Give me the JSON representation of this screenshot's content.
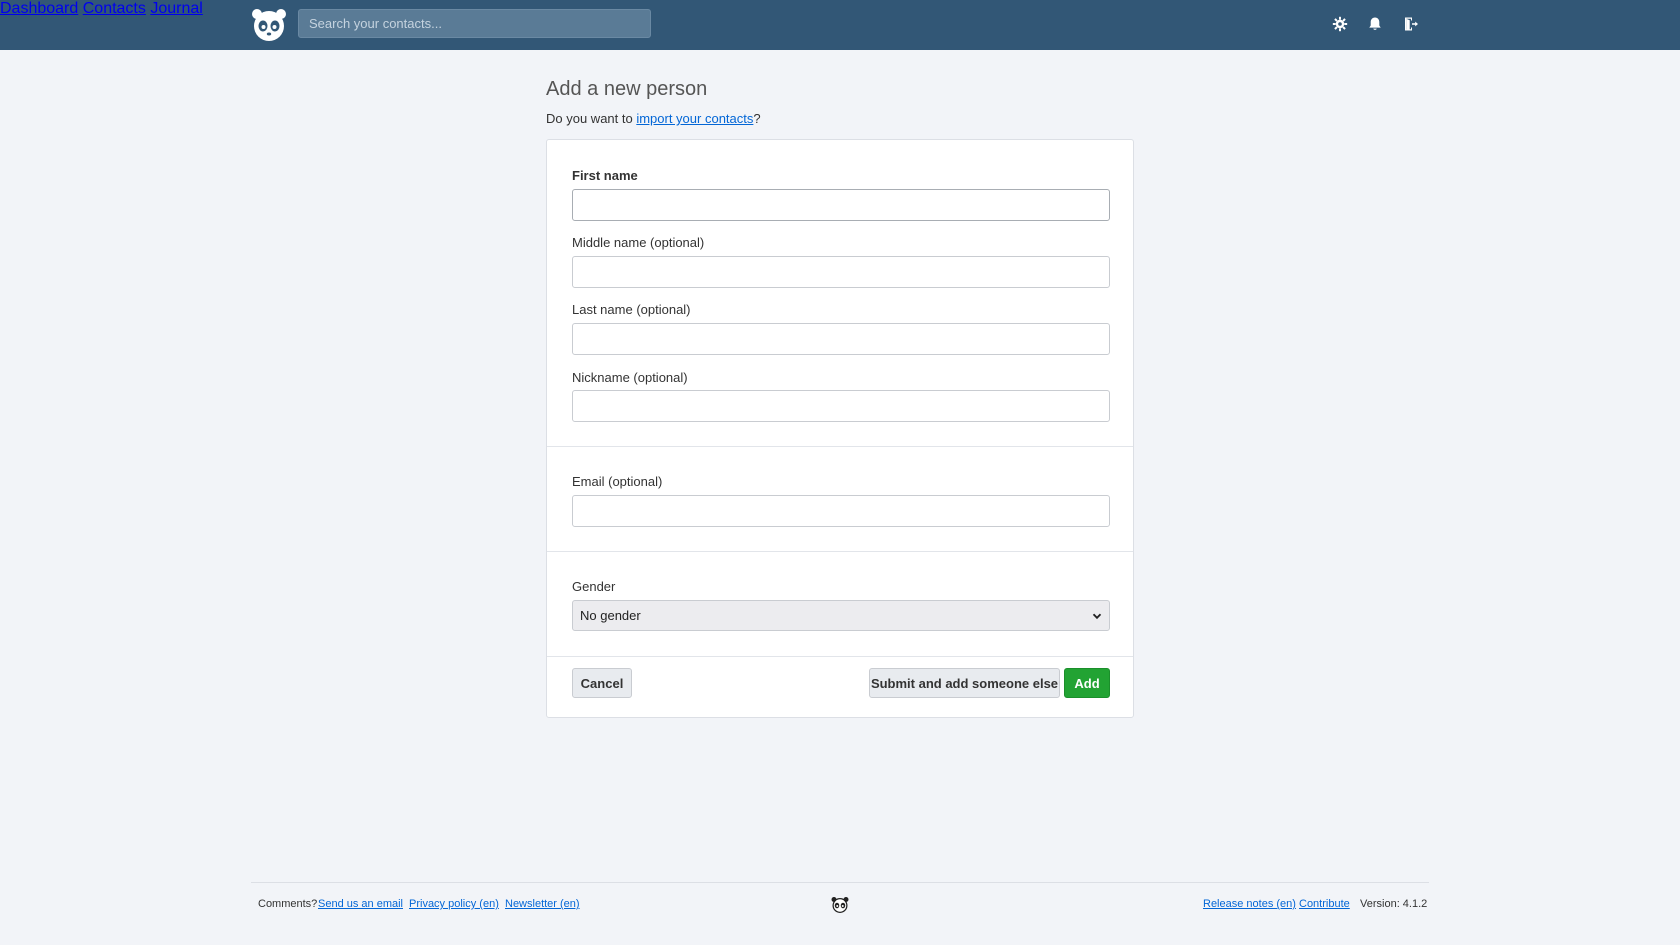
{
  "header": {
    "search_placeholder": "Search your contacts...",
    "nav": {
      "dashboard": "Dashboard",
      "contacts": "Contacts",
      "journal": "Journal"
    },
    "icons": [
      "settings-icon",
      "bell-icon",
      "logout-icon"
    ]
  },
  "main": {
    "title": "Add a new person",
    "import_prefix": "Do you want to ",
    "import_link": "import your contacts",
    "import_suffix": "?"
  },
  "form": {
    "first_name_label": "First name",
    "first_name_value": "",
    "middle_name_label": "Middle name (optional)",
    "middle_name_value": "",
    "last_name_label": "Last name (optional)",
    "last_name_value": "",
    "nickname_label": "Nickname (optional)",
    "nickname_value": "",
    "email_label": "Email (optional)",
    "email_value": "",
    "gender_label": "Gender",
    "gender_selected": "No gender",
    "cancel_label": "Cancel",
    "submit_more_label": "Submit and add someone else",
    "add_label": "Add"
  },
  "footer": {
    "comments": "Comments?",
    "send_email": "Send us an email",
    "privacy": "Privacy policy (en)",
    "newsletter": "Newsletter (en)",
    "release_notes": "Release notes (en)",
    "contribute": "Contribute",
    "version": "Version: 4.1.2"
  },
  "colors": {
    "header_bg": "#325776",
    "page_bg": "#f2f4f8",
    "link": "#0366d6",
    "add_button": "#22a333"
  }
}
